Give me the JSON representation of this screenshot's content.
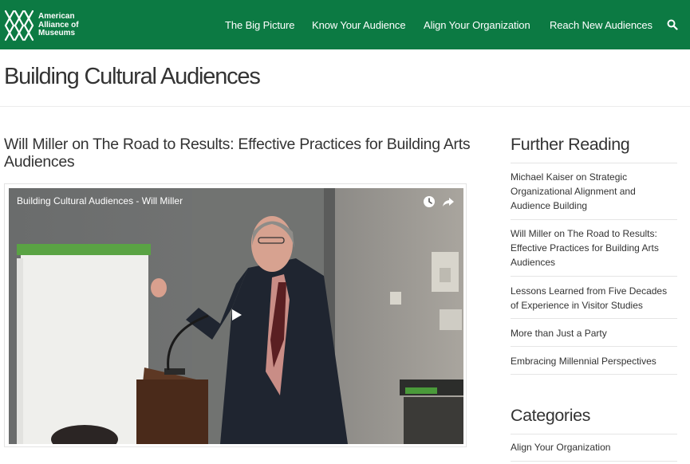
{
  "brand": {
    "logo_lines": [
      "American",
      "Alliance of",
      "Museums"
    ]
  },
  "nav": {
    "items": [
      "The Big Picture",
      "Know Your Audience",
      "Align Your Organization",
      "Reach New Audiences"
    ],
    "search_icon": "search-icon"
  },
  "page": {
    "title": "Building Cultural Audiences"
  },
  "post": {
    "title": "Will Miller on The Road to Results: Effective Practices for Building Arts Audiences"
  },
  "video": {
    "title": "Building Cultural Audiences - Will Miller",
    "icons": [
      "clock-icon",
      "share-icon",
      "play-icon"
    ]
  },
  "sidebar": {
    "further_reading": {
      "heading": "Further Reading",
      "links": [
        "Michael Kaiser on Strategic Organizational Alignment and Audience Building",
        "Will Miller on The Road to Results: Effective Practices for Building Arts Audiences",
        "Lessons Learned from Five Decades of Experience in Visitor Studies",
        "More than Just a Party",
        "Embracing Millennial Perspectives"
      ]
    },
    "categories": {
      "heading": "Categories",
      "links": [
        "Align Your Organization"
      ]
    }
  },
  "colors": {
    "brand_green": "#0c7a43",
    "text": "#333333"
  }
}
